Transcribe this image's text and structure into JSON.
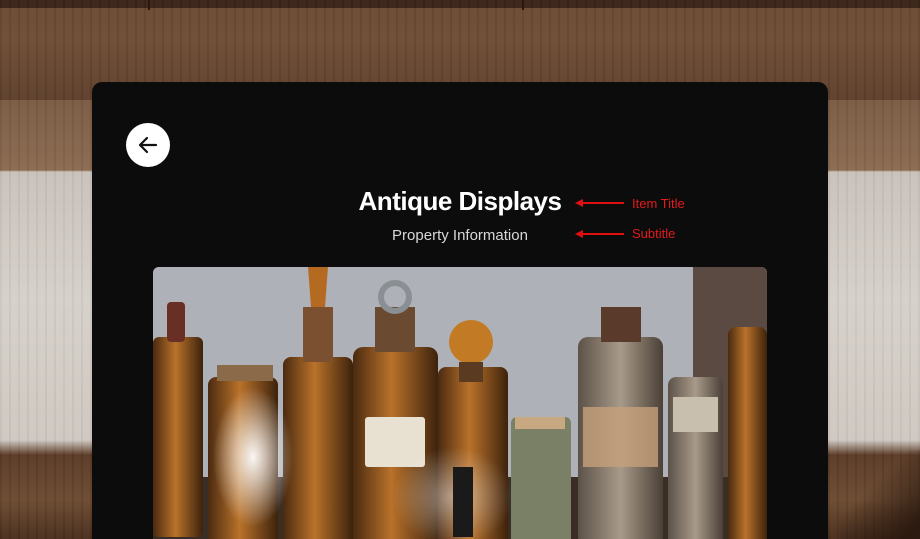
{
  "item": {
    "title": "Antique Displays",
    "subtitle": "Property Information"
  },
  "annotations": {
    "title_label": "Item Title",
    "subtitle_label": "Subtitle"
  },
  "icons": {
    "back": "arrow-left-icon"
  },
  "colors": {
    "card_background": "#0c0c0d",
    "annotation": "#e01010",
    "title_text": "#ffffff",
    "subtitle_text": "#d8d8d8"
  }
}
